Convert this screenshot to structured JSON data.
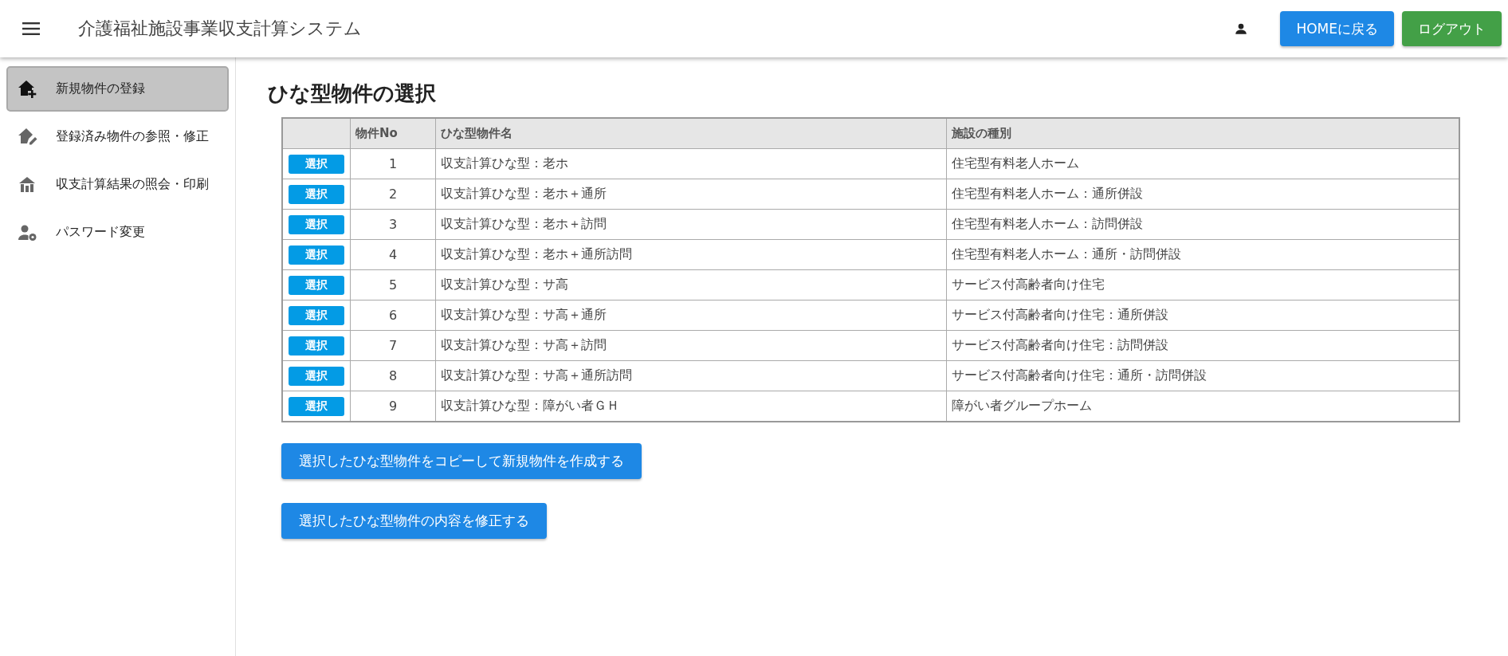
{
  "header": {
    "title": "介護福祉施設事業収支計算システム",
    "buttons": [
      {
        "label": "HOMEに戻る",
        "kind": "home"
      },
      {
        "label": "ログアウト",
        "kind": "logout"
      }
    ]
  },
  "sidebar": {
    "items": [
      {
        "label": "新規物件の登録",
        "kind": "add",
        "selected": true
      },
      {
        "label": "登録済み物件の参照・修正",
        "kind": "edit",
        "selected": false
      },
      {
        "label": "収支計算結果の照会・印刷",
        "kind": "report",
        "selected": false
      },
      {
        "label": "パスワード変更",
        "kind": "password",
        "selected": false
      }
    ]
  },
  "page_title": "ひな型物件の選択",
  "table": {
    "columns": [
      "",
      "物件No",
      "ひな型物件名",
      "施設の種別"
    ],
    "rows": [
      {
        "action": "選択",
        "no": "1",
        "name": "収支計算ひな型：老ホ",
        "type": "住宅型有料老人ホーム"
      },
      {
        "action": "選択",
        "no": "2",
        "name": "収支計算ひな型：老ホ＋通所",
        "type": "住宅型有料老人ホーム：通所併設"
      },
      {
        "action": "選択",
        "no": "3",
        "name": "収支計算ひな型：老ホ＋訪問",
        "type": "住宅型有料老人ホーム：訪問併設"
      },
      {
        "action": "選択",
        "no": "4",
        "name": "収支計算ひな型：老ホ＋通所訪問",
        "type": "住宅型有料老人ホーム：通所・訪問併設"
      },
      {
        "action": "選択",
        "no": "5",
        "name": "収支計算ひな型：サ高",
        "type": "サービス付高齢者向け住宅"
      },
      {
        "action": "選択",
        "no": "6",
        "name": "収支計算ひな型：サ高＋通所",
        "type": "サービス付高齢者向け住宅：通所併設"
      },
      {
        "action": "選択",
        "no": "7",
        "name": "収支計算ひな型：サ高＋訪問",
        "type": "サービス付高齢者向け住宅：訪問併設"
      },
      {
        "action": "選択",
        "no": "8",
        "name": "収支計算ひな型：サ高＋通所訪問",
        "type": "サービス付高齢者向け住宅：通所・訪問併設"
      },
      {
        "action": "選択",
        "no": "9",
        "name": "収支計算ひな型：障がい者ＧＨ",
        "type": "障がい者グループホーム"
      }
    ]
  },
  "actions": [
    "選択したひな型物件をコピーして新規物件を作成する",
    "選択したひな型物件の内容を修正する"
  ]
}
